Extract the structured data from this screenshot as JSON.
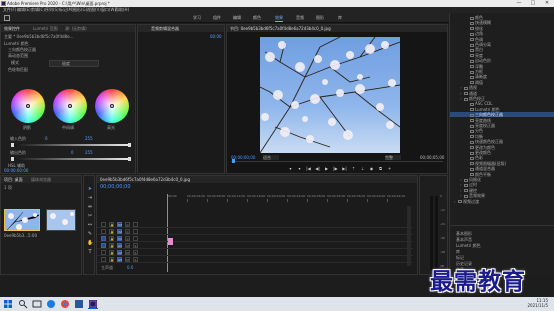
{
  "titlebar": {
    "title": "Adobe Premiere Pro 2020 - C:\\用户\\Win\\桌面.prproj *",
    "minimize": "—",
    "maximize": "□",
    "close": "✕"
  },
  "menubar": {
    "items": [
      "文件(F)",
      "编辑(E)",
      "剪辑(C)",
      "序列(S)",
      "标记(M)",
      "图形(G)",
      "视图(V)",
      "窗口(W)",
      "帮助(H)"
    ]
  },
  "workspaces": {
    "items": [
      "学习",
      "组件",
      "编辑",
      "颜色",
      "效果",
      "音频",
      "图形",
      "库"
    ],
    "active_index": 4
  },
  "lumetri": {
    "tabs": [
      "效果控件",
      "Lumetri 范围",
      "源: (无剪辑)",
      "音频剪辑混合器: 0.jpg"
    ],
    "active_tab": 0,
    "clip_label": "主要 * 0ee9b5b3bd6f5c7a0f4d8e...",
    "fx_label": "Lumetri 颜色",
    "hdr_label": "高动态范围",
    "curves_label": "曲线",
    "basic_label": "三向颜色校正器",
    "hsl_label": "色调饱和度曲线",
    "mode_label": "模式",
    "mode_value": "极度",
    "wheels_label": "色轮和匹配",
    "wheel_labels": [
      "阴影",
      "中间调",
      "高光"
    ],
    "input_label": "输入色阶",
    "input_values": [
      "0",
      "255"
    ],
    "output_label": "输出色阶",
    "output_values": [
      "0",
      "255"
    ],
    "saturation_label": "饱和度",
    "hsl_secondary_label": "HSL 辅助",
    "vignette_label": "晕影",
    "timecode": "00:00:00:00"
  },
  "source": {
    "tabs": [
      "音频剪辑混合器"
    ],
    "timecode": "00:00"
  },
  "program": {
    "title": "节目: 0ee9b5b3bd6f5c7a0f4d8e6a72d3b4c0_0.jpg",
    "timecode_left": "00;00;00;00",
    "fit": "适合",
    "quality": "完整",
    "timecode_right": "00;00;05;00",
    "controls": [
      "标记入点",
      "标记出点",
      "转到入点",
      "后退一帧",
      "播放",
      "前进一帧",
      "转到出点",
      "提升",
      "提取",
      "导出帧",
      "比较视图",
      "添加"
    ]
  },
  "effects": {
    "items": [
      {
        "label": "颜色",
        "depth": 2
      },
      {
        "label": "快速模糊",
        "depth": 2
      },
      {
        "label": "锐化",
        "depth": 2
      },
      {
        "label": "边角",
        "depth": 2
      },
      {
        "label": "色调",
        "depth": 2
      },
      {
        "label": "色调分离",
        "depth": 2
      },
      {
        "label": "黑白",
        "depth": 2
      },
      {
        "label": "亮度",
        "depth": 2
      },
      {
        "label": "自动色阶",
        "depth": 2
      },
      {
        "label": "浮雕",
        "depth": 2
      },
      {
        "label": "方框",
        "depth": 2
      },
      {
        "label": "清晰度",
        "depth": 2
      },
      {
        "label": "阈值",
        "depth": 2
      },
      {
        "label": "透视",
        "depth": 1
      },
      {
        "label": "通道",
        "depth": 1
      },
      {
        "label": "颜色校正",
        "depth": 1
      },
      {
        "label": "ASC CDL",
        "depth": 2
      },
      {
        "label": "Lumetri 颜色",
        "depth": 2
      },
      {
        "label": "三向颜色校正器",
        "depth": 2,
        "selected": true
      },
      {
        "label": "亮度曲线",
        "depth": 2
      },
      {
        "label": "亮度校正器",
        "depth": 2
      },
      {
        "label": "分色",
        "depth": 2
      },
      {
        "label": "均衡",
        "depth": 2
      },
      {
        "label": "快速颜色校正器",
        "depth": 2
      },
      {
        "label": "更改为颜色",
        "depth": 2
      },
      {
        "label": "更改颜色",
        "depth": 2
      },
      {
        "label": "色彩",
        "depth": 2
      },
      {
        "label": "视频限幅器(旧版)",
        "depth": 2
      },
      {
        "label": "通道混合器",
        "depth": 2
      },
      {
        "label": "颜色平衡",
        "depth": 2
      },
      {
        "label": "风格化",
        "depth": 1
      },
      {
        "label": "过时",
        "depth": 1
      },
      {
        "label": "键控",
        "depth": 1
      },
      {
        "label": "音频效果",
        "depth": 1
      },
      {
        "label": "视频过渡",
        "depth": 0
      }
    ],
    "lower": {
      "items": [
        "基本图形",
        "基本声音",
        "Lumetri 颜色",
        "库",
        "标记",
        "历史记录",
        "信息"
      ]
    }
  },
  "project": {
    "tabs": [
      "项目: 桌面",
      "媒体浏览器"
    ],
    "item_count": "1 项",
    "clip_name": "0ee9b5b3...",
    "clip_duration": "5:00"
  },
  "timeline": {
    "title": "0ee9b5b3bd6f5c7a0f4d8e6a72d3b4c0_0.jpg",
    "timecode": "00;00;00;00",
    "ruler": [
      ";00;00",
      "00;00;04;00",
      "00;00;08;00",
      "00;00;12;00",
      "00;00;16;00",
      "00;00;20;00",
      "00;00;24;00",
      "00;00;28;00",
      "00;00;32;00",
      "00;00;36;00",
      "00;00;40;00",
      "00;00;44;00"
    ],
    "tracks": [
      {
        "label": "V3",
        "type": "video"
      },
      {
        "label": "V2",
        "type": "video"
      },
      {
        "label": "V1",
        "type": "video"
      },
      {
        "label": "A1",
        "type": "audio"
      },
      {
        "label": "A2",
        "type": "audio"
      },
      {
        "label": "A3",
        "type": "audio"
      }
    ],
    "master_label": "主声道",
    "master_value": "0.0"
  },
  "meters": {
    "labels": [
      "0",
      "-12",
      "-24",
      "-36",
      "-48",
      "dB"
    ]
  },
  "taskbar": {
    "time": "11:15",
    "date": "2021/11/5"
  },
  "watermark": {
    "text": "最需教育"
  },
  "colors": {
    "accent": "#2d8cf0",
    "selected": "#2a4a7a",
    "clip_pink": "#e58ccf"
  }
}
